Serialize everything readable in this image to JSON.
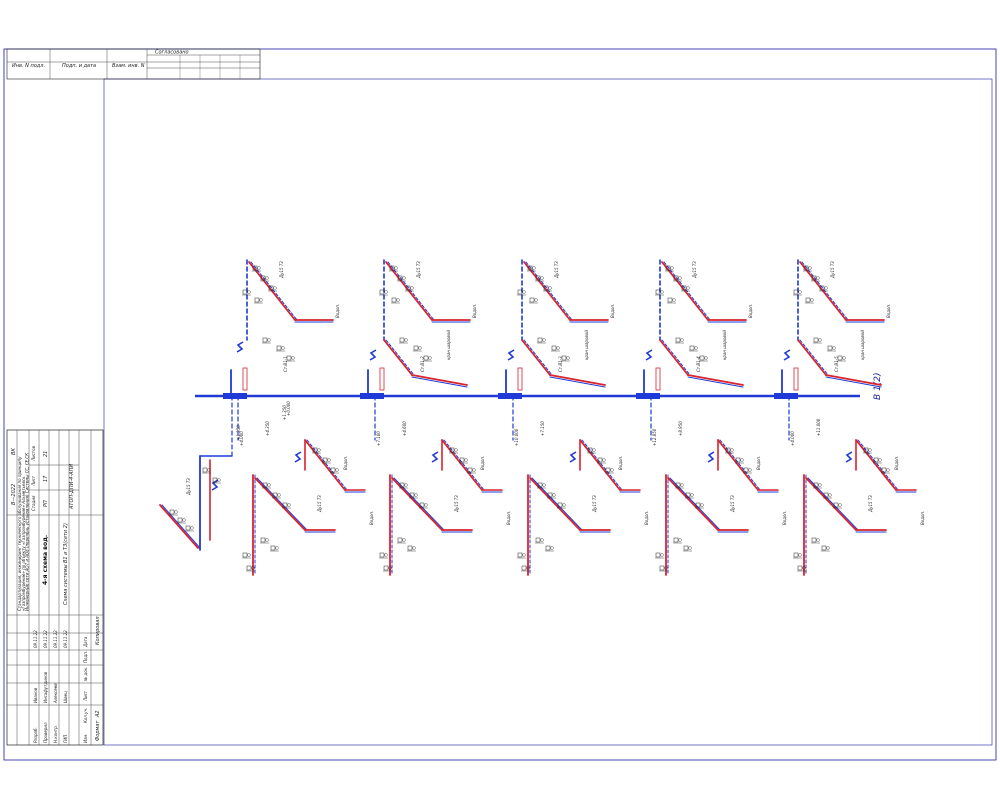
{
  "stamp_top": {
    "approval": "Согласовано",
    "inv_podl": "Инв. N подл.",
    "podp_data": "Подп. и дата",
    "vzam_inv": "Взам. инв. N"
  },
  "title_block": {
    "code": "ВК",
    "year": "В—2022",
    "company_lines": [
      "Стандартизация, инжиниринг технического обслуживания по принципу",
      "«Газпромбурение» по объекту «Газпромбурение» Альметьевск",
      "Инженерные сети АО7 и АО8 (перечень установления) Системы СС, СЕ,СК"
    ],
    "drawing_title": "4-я схема вод.",
    "sheet_desc": "Схема системы В1 и Т3(сети 2)",
    "stage_label": "Стадия",
    "sheet_label": "Лист",
    "sheets_label": "Листов",
    "stage": "РП",
    "sheet": "17",
    "sheets": "21",
    "roles": [
      "Разраб.",
      "Проверил",
      "Н.контр.",
      "ГИП"
    ],
    "names": [
      "Иванов",
      "Инсафутдинов",
      "Алексеев",
      "Швец"
    ],
    "dates": [
      "09.11.22",
      "09.11.22",
      "09.11.22",
      "09.11.22"
    ],
    "header_cols": [
      "Изм.",
      "Кол.уч.",
      "Лист",
      "№ док.",
      "Подп.",
      "Дата"
    ],
    "org_code": "АТОП-ДПИ-4-АПИ",
    "copied": "Копировал",
    "format": "Формат",
    "format_val": "А2"
  },
  "diagram": {
    "main_line_label": "В 1(2)",
    "main_line_elevation": "+0.000",
    "basement_label": "+1.350",
    "floor_labels_lower": [
      "+1.350",
      "+4.350",
      "+4.600",
      "+7.150",
      "+8.950",
      "+11.000",
      "+10.350"
    ],
    "floor_labels_upper": [
      "+4.000",
      "+7.100",
      "+10.000",
      "+12.850"
    ],
    "riser_labels": [
      "Ст.В1-1",
      "Ст.В1-2",
      "Ст.В1-3",
      "Ст.В1-4",
      "Ст.В1-5"
    ],
    "fixture_tag": "Водоп.",
    "pipe_tag": "Ду15 Т3",
    "valve_note": "кран шаровой",
    "colors": {
      "cold": "#1f3ad6",
      "hot": "#d9232d",
      "frame": "#1a1aa0",
      "ink": "#222222"
    }
  }
}
